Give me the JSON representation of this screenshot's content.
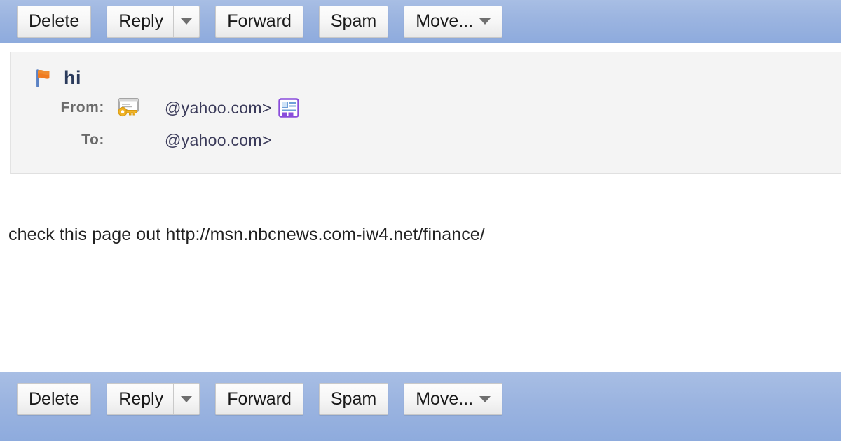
{
  "toolbar_top": {
    "buttons": [
      {
        "label": "Delete",
        "type": "plain",
        "name": "delete-button"
      },
      {
        "label": "Reply",
        "type": "split",
        "name": "reply-button"
      },
      {
        "label": "Forward",
        "type": "plain",
        "name": "forward-button"
      },
      {
        "label": "Spam",
        "type": "plain",
        "name": "spam-button"
      },
      {
        "label": "Move...",
        "type": "dropdown",
        "name": "move-button"
      }
    ]
  },
  "toolbar_bottom": {
    "buttons": [
      {
        "label": "Delete",
        "type": "plain",
        "name": "delete-button"
      },
      {
        "label": "Reply",
        "type": "split",
        "name": "reply-button"
      },
      {
        "label": "Forward",
        "type": "plain",
        "name": "forward-button"
      },
      {
        "label": "Spam",
        "type": "plain",
        "name": "spam-button"
      },
      {
        "label": "Move...",
        "type": "dropdown",
        "name": "move-button"
      }
    ]
  },
  "message": {
    "subject": "hi",
    "flag_icon": "flag-icon",
    "from": {
      "label": "From:",
      "address": "@yahoo.com>",
      "cert_icon": "certificate-key-icon",
      "contact_icon": "add-to-contacts-icon"
    },
    "to": {
      "label": "To:",
      "address": "@yahoo.com>"
    },
    "body": "check this page out http://msn.nbcnews.com-iw4.net/finance/"
  },
  "colors": {
    "toolbar_blue": "#9bb4e0",
    "header_panel": "#f4f4f4",
    "flag_orange": "#f07a20",
    "label_gray": "#6a6a6a",
    "subject_navy": "#2b3b5c",
    "contact_purple": "#8a4ddb"
  }
}
